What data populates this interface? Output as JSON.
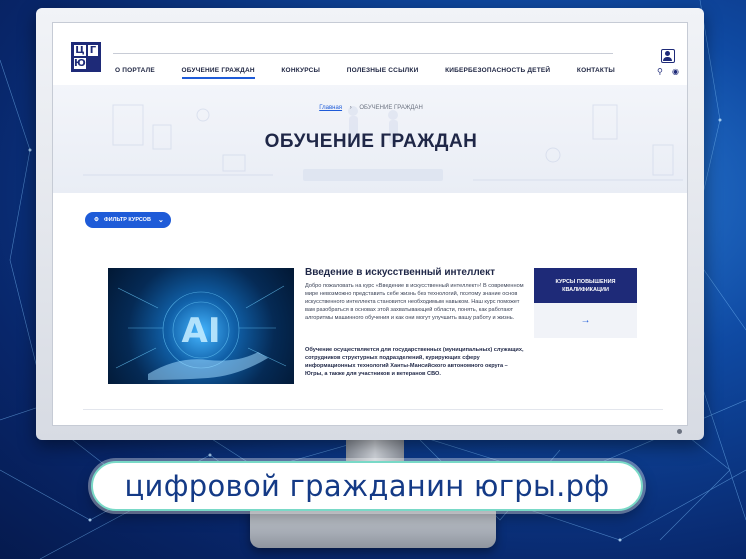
{
  "logo": {
    "letters": [
      "Ц",
      "Г",
      "Ю",
      ""
    ]
  },
  "nav": {
    "items": [
      {
        "label": "О ПОРТАЛЕ",
        "active": false
      },
      {
        "label": "ОБУЧЕНИЕ ГРАЖДАН",
        "active": true
      },
      {
        "label": "КОНКУРСЫ",
        "active": false
      },
      {
        "label": "ПОЛЕЗНЫЕ ССЫЛКИ",
        "active": false
      },
      {
        "label": "КИБЕРБЕЗОПАСНОСТЬ ДЕТЕЙ",
        "active": false
      },
      {
        "label": "КОНТАКТЫ",
        "active": false
      }
    ],
    "search_icon": "⚲",
    "eye_icon": "◉"
  },
  "breadcrumb": {
    "home": "Главная",
    "separator": "›",
    "current": "ОБУЧЕНИЕ ГРАЖДАН"
  },
  "page_title": "ОБУЧЕНИЕ ГРАЖДАН",
  "filter": {
    "label": "ФИЛЬТР КУРСОВ",
    "icon": "⚙",
    "chevron": "⌄"
  },
  "course": {
    "image_text": "AI",
    "title": "Введение в искусственный интеллект",
    "description": "Добро пожаловать на курс «Введение в искусственный интеллект»! В современном мире невозможно представить себе жизнь без технологий, поэтому знание основ искусственного интеллекта становится необходимым навыком. Наш курс поможет вам разобраться в основах этой захватывающей области, понять, как работают алгоритмы машинного обучения и как они могут улучшить вашу работу и жизнь.",
    "note": "Обучение осуществляется для государственных (муниципальных) служащих, сотрудников структурных подразделений, курирующих сферу информационных технологий Ханты-Мансийского автономного округа – Югры, а также для участников и ветеранов СВО.",
    "tag": "КУРСЫ ПОВЫШЕНИЯ КВАЛИФИКАЦИИ",
    "arrow": "→"
  },
  "banner": {
    "text": "цифровой гражданин югры.рф"
  },
  "colors": {
    "primary": "#1e5bd8",
    "dark_navy": "#1e2a78",
    "banner_border": "#79d9c7",
    "banner_text": "#143a86"
  }
}
